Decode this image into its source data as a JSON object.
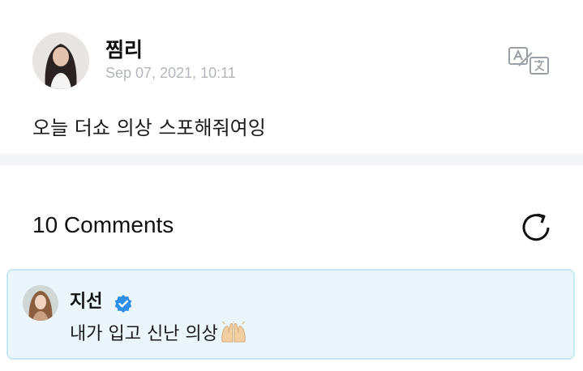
{
  "post": {
    "author": "찜리",
    "timestamp": "Sep 07, 2021, 10:11",
    "text": "오늘 더쇼 의상 스포해줘여잉"
  },
  "comments": {
    "header": "10 Comments"
  },
  "comment": {
    "author": "지선",
    "text": "내가 입고 신난 의상"
  },
  "icons": {
    "translate": "translate-icon",
    "refresh": "refresh-icon",
    "verified": "verified-badge-icon",
    "emoji": "raising-hands-emoji"
  },
  "colors": {
    "verified_blue": "#2f8fe8",
    "card_bg": "#eaf6fc",
    "card_border": "#c8e7f4",
    "timestamp_gray": "#b3b6bd"
  }
}
